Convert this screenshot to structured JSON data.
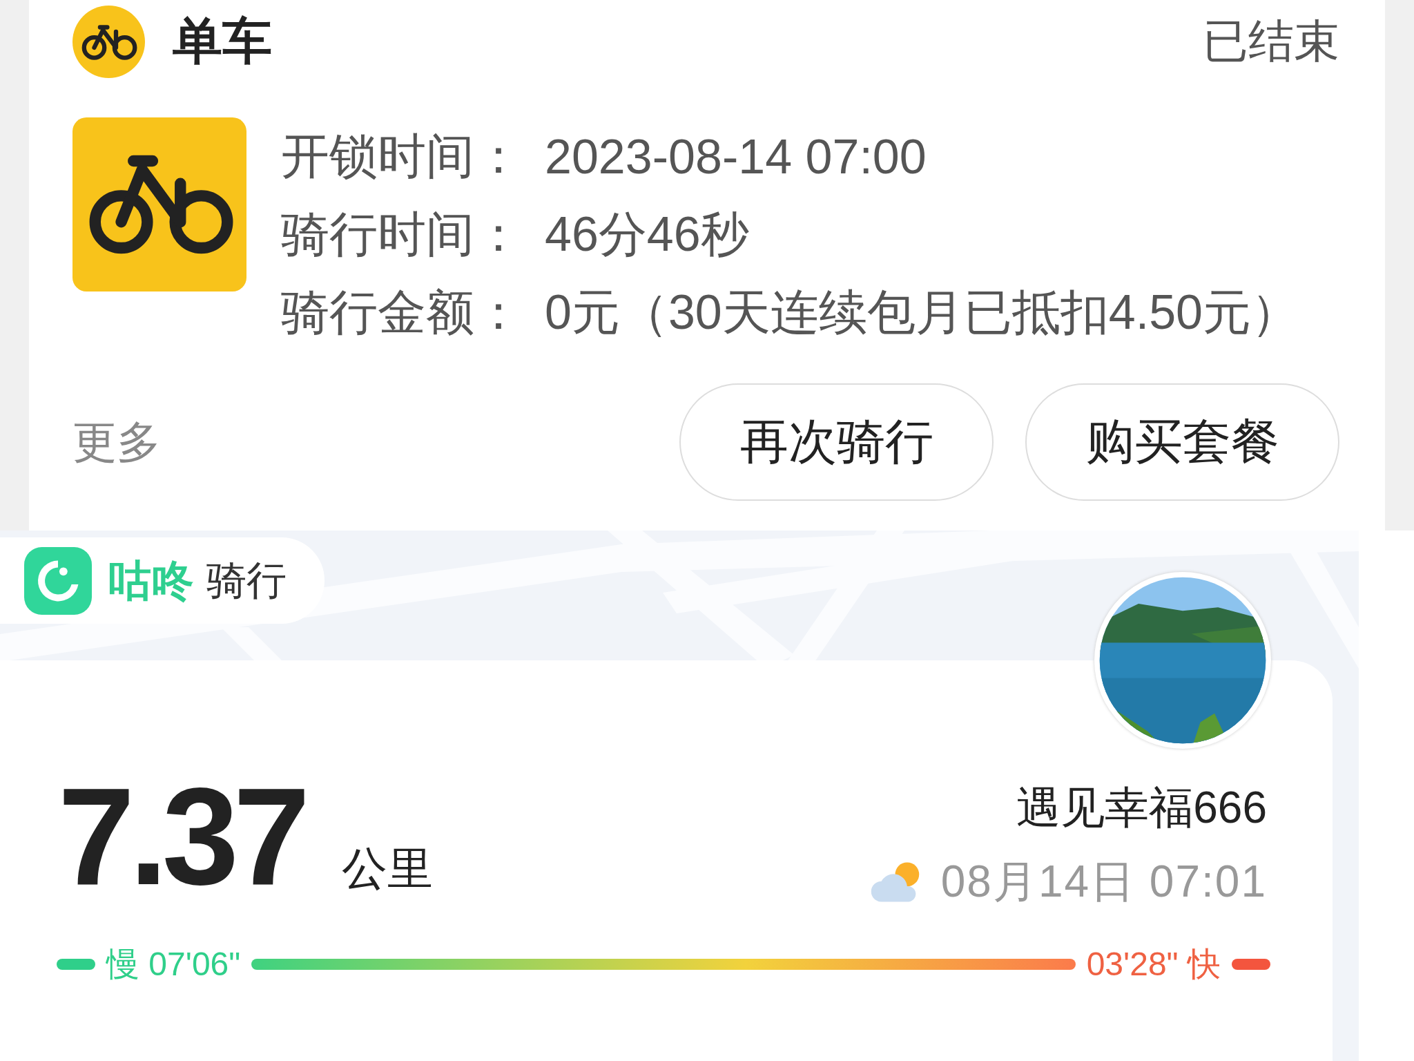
{
  "ride_card": {
    "title": "单车",
    "status": "已结束",
    "details": [
      {
        "label": "开锁时间：",
        "value": "2023-08-14 07:00"
      },
      {
        "label": "骑行时间：",
        "value": "46分46秒"
      },
      {
        "label": "骑行金额：",
        "value": "0元（30天连续包月已抵扣4.50元）"
      }
    ],
    "more": "更多",
    "buttons": [
      "再次骑行",
      "购买套餐"
    ]
  },
  "activity": {
    "brand": "咕咚",
    "brand_suffix": "骑行",
    "distance": "7.37",
    "unit": "公里",
    "user_name": "遇见幸福666",
    "datetime": "08月14日 07:01",
    "pace_slow": "慢 07'06\"",
    "pace_fast": "03'28\" 快"
  }
}
